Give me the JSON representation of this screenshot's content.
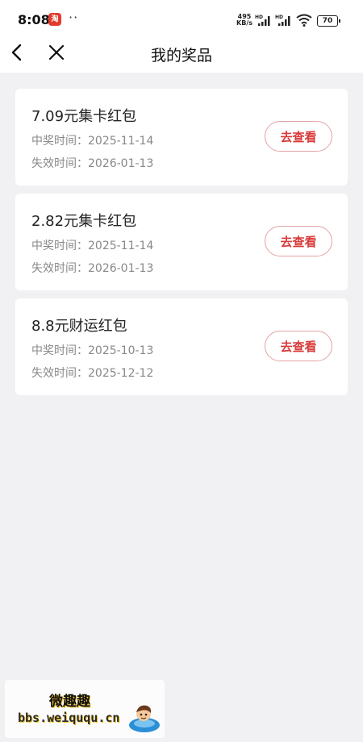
{
  "status_bar": {
    "time": "8:08",
    "app_badge": "淘",
    "more": "··",
    "net_speed_value": "495",
    "net_speed_unit": "KB/s",
    "signal1_label": "HD",
    "signal2_label": "HD",
    "battery": "70"
  },
  "nav": {
    "title": "我的奖品"
  },
  "prizes": [
    {
      "name": "7.09元集卡红包",
      "won_label": "中奖时间：",
      "won_date": "2025-11-14",
      "expire_label": "失效时间：",
      "expire_date": "2026-01-13",
      "action": "去查看"
    },
    {
      "name": "2.82元集卡红包",
      "won_label": "中奖时间：",
      "won_date": "2025-11-14",
      "expire_label": "失效时间：",
      "expire_date": "2026-01-13",
      "action": "去查看"
    },
    {
      "name": "8.8元财运红包",
      "won_label": "中奖时间：",
      "won_date": "2025-10-13",
      "expire_label": "失效时间：",
      "expire_date": "2025-12-12",
      "action": "去查看"
    }
  ],
  "watermark": {
    "title": "微趣趣",
    "url": "bbs.weiququ.cn"
  },
  "colors": {
    "accent": "#d83a3a",
    "accent_border": "#e3a3a3",
    "background": "#f1f1f3",
    "card": "#ffffff",
    "secondary_text": "#888888"
  },
  "icons": {
    "back": "chevron-left-icon",
    "close": "close-icon",
    "wifi": "wifi-icon",
    "signal": "signal-icon",
    "battery": "battery-icon"
  }
}
